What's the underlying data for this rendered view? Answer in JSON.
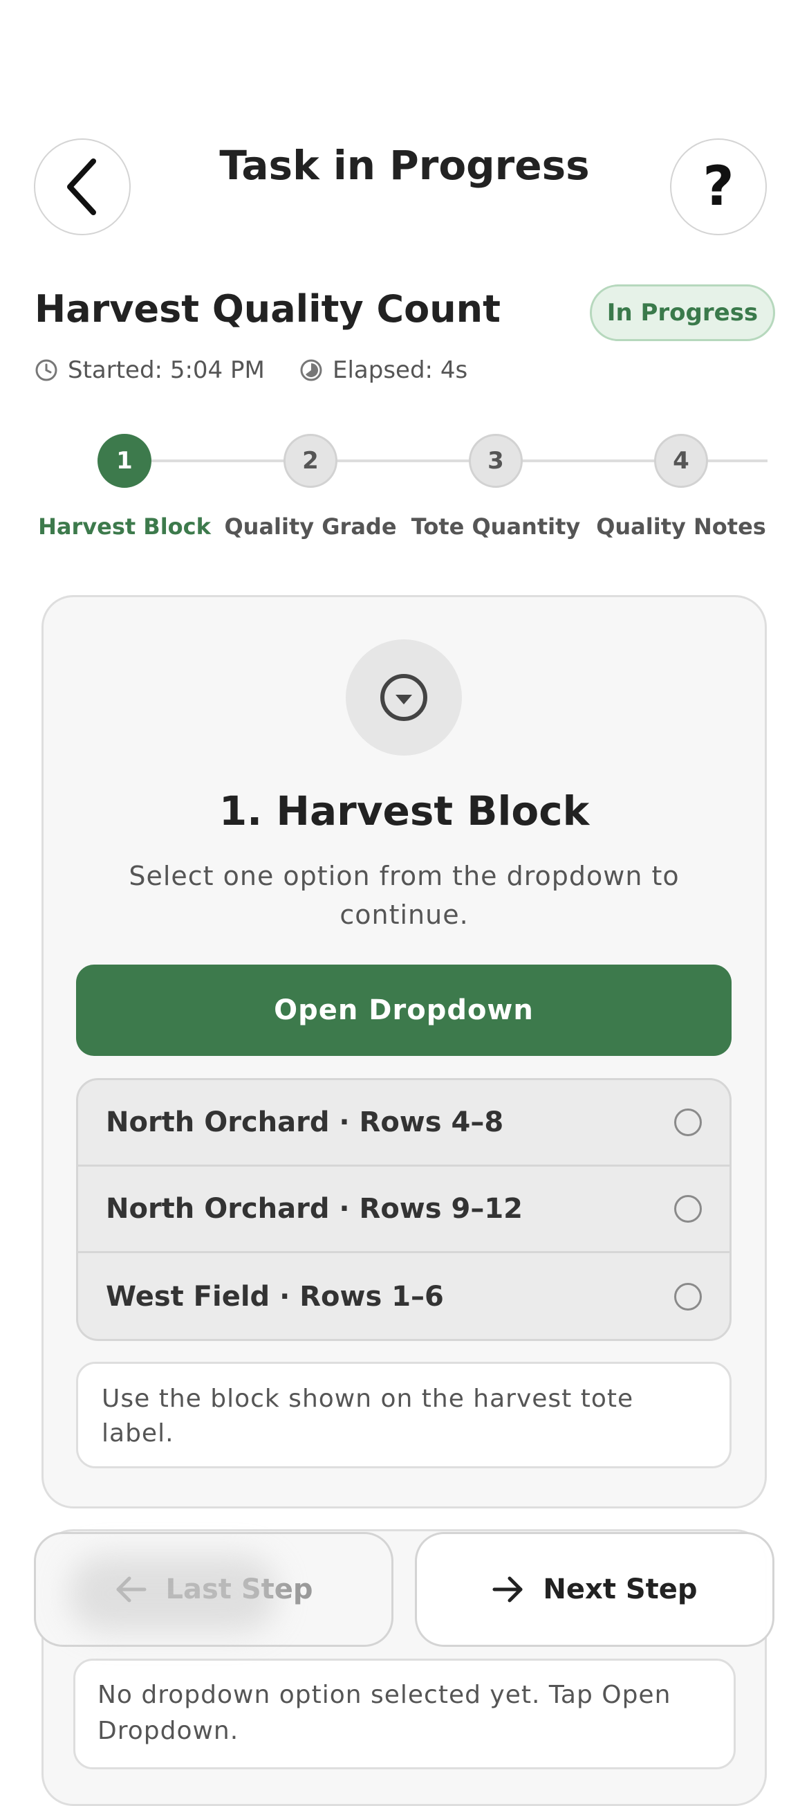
{
  "header": {
    "title": "Task in Progress",
    "back_icon": "chevron-left-icon",
    "help_label": "?"
  },
  "task": {
    "name": "Harvest Quality Count",
    "status": "In Progress",
    "started": "Started: 5:04 PM",
    "elapsed": "Elapsed: 4s"
  },
  "steps": [
    {
      "number": "1",
      "label": "Harvest Block",
      "state": "current"
    },
    {
      "number": "2",
      "label": "Quality Grade",
      "state": "upcoming"
    },
    {
      "number": "3",
      "label": "Tote Quantity",
      "state": "upcoming"
    },
    {
      "number": "4",
      "label": "Quality Notes",
      "state": "upcoming"
    }
  ],
  "card": {
    "icon": "dropdown-circle-icon",
    "title": "1. Harvest Block",
    "subtitle": "Select one option from the dropdown to continue.",
    "open_button": "Open Dropdown",
    "options": [
      {
        "label": "North Orchard · Rows 4–8",
        "selected": false
      },
      {
        "label": "North Orchard · Rows 9–12",
        "selected": false
      },
      {
        "label": "West Field · Rows 1–6",
        "selected": false
      }
    ],
    "hint": "Use the block shown on the harvest tote label."
  },
  "navigation": {
    "prev_label": "Last Step",
    "next_label": "Next Step"
  },
  "status_message": "No dropdown option selected yet. Tap Open Dropdown.",
  "colors": {
    "accent": "#3d7a4c",
    "pill_bg": "#e6f2e8",
    "pill_border": "#b6d8bd"
  }
}
